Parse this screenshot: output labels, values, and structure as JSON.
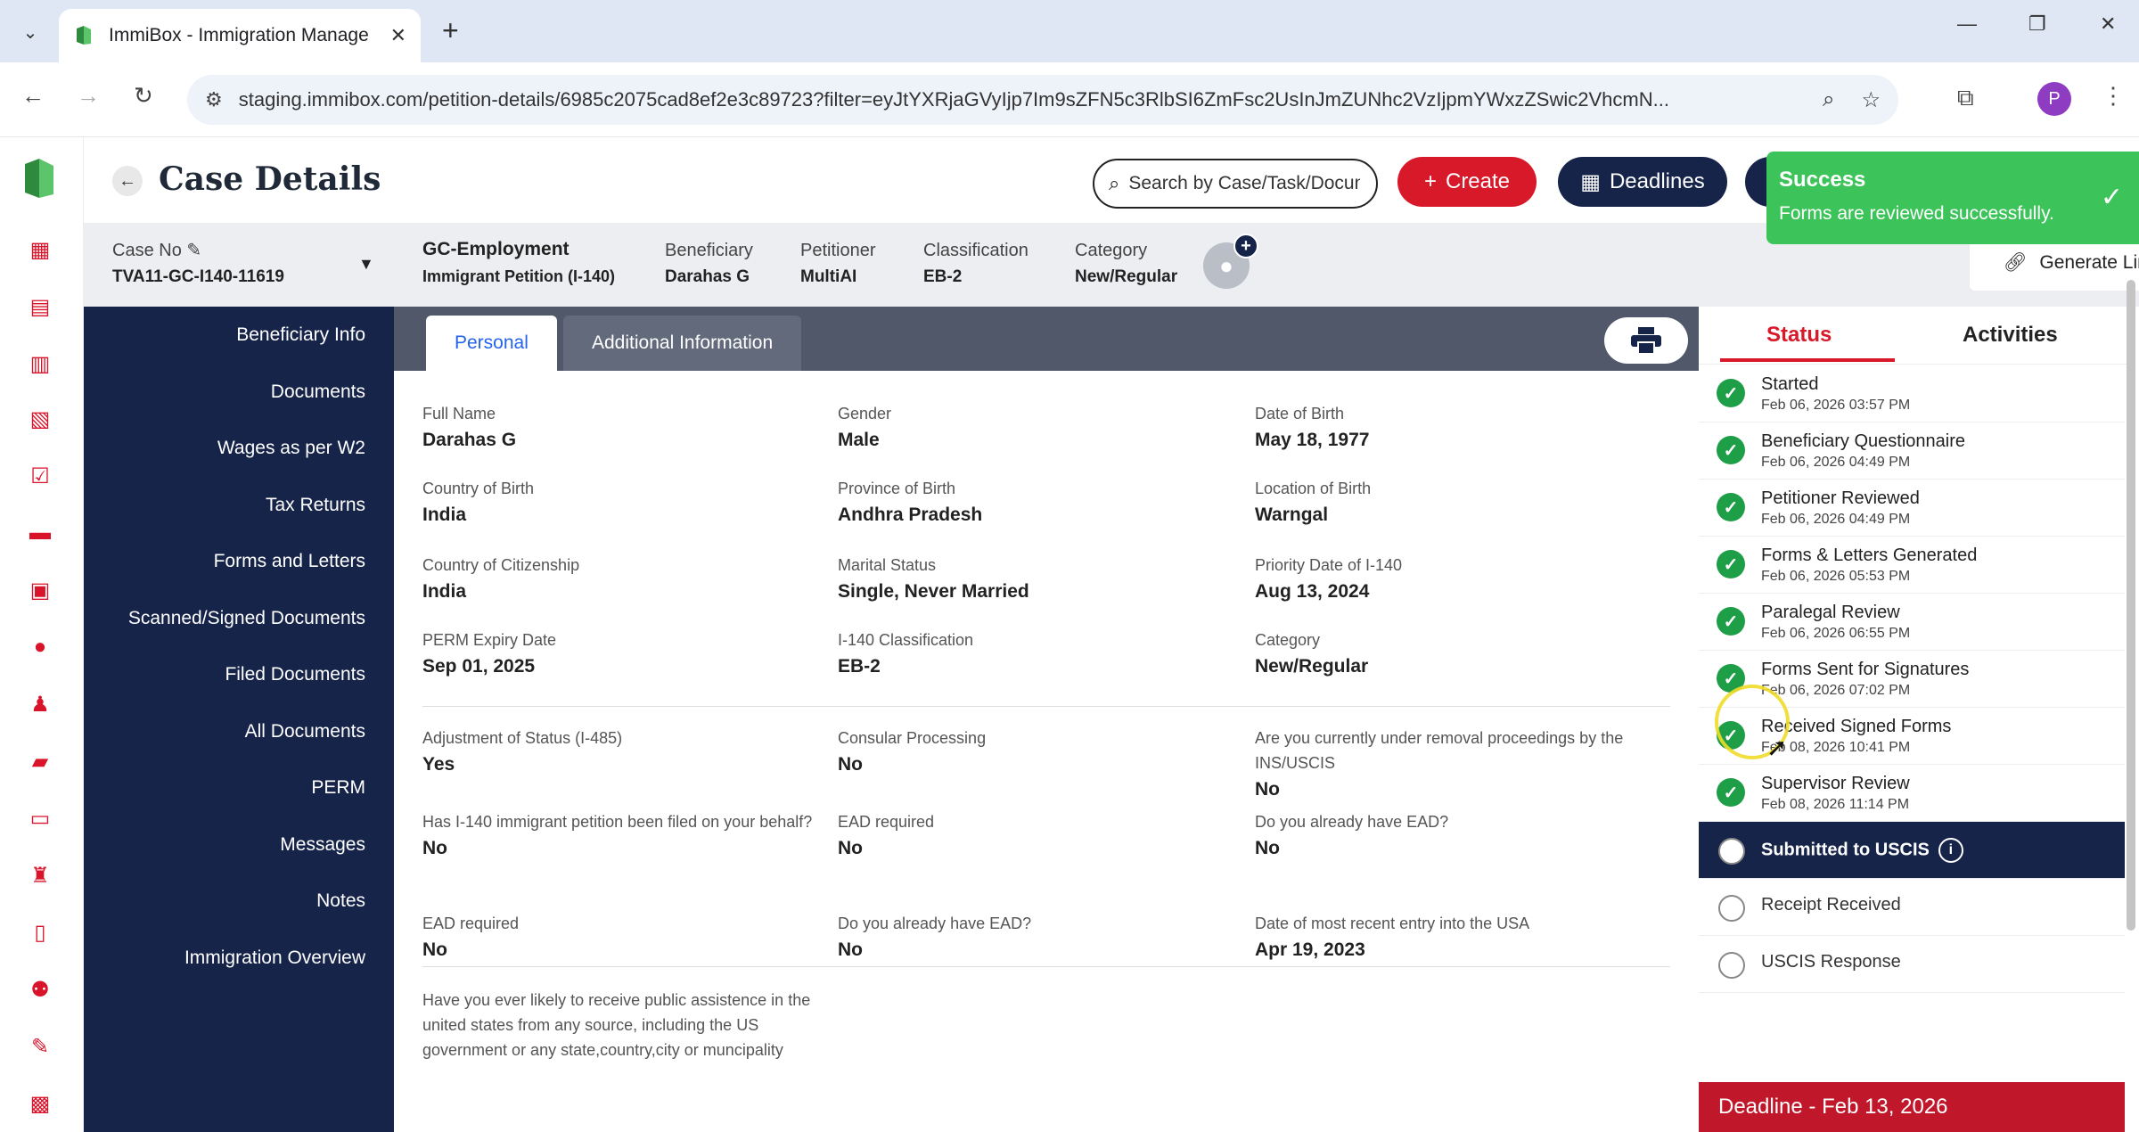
{
  "browser": {
    "tab_title": "ImmiBox - Immigration Manage",
    "url": "staging.immibox.com/petition-details/6985c2075cad8ef2e3c89723?filter=eyJtYXRjaGVyIjp7Im9sZFN5c3RlbSI6ZmFsc2UsInJmZUNhc2VzIjpmYWxzZSwic2VhcmN...",
    "profile_initial": "P"
  },
  "header": {
    "title": "Case Details",
    "search_placeholder": "Search by Case/Task/Document",
    "create_label": "Create",
    "deadlines_label": "Deadlines"
  },
  "toast": {
    "title": "Success",
    "message": "Forms are reviewed successfully."
  },
  "case_bar": {
    "case_no_label": "Case No",
    "case_no": "TVA11-GC-I140-11619",
    "case_type": "GC-Employment",
    "case_subtype": "Immigrant Petition (I-140)",
    "beneficiary_label": "Beneficiary",
    "beneficiary": "Darahas G",
    "petitioner_label": "Petitioner",
    "petitioner": "MultiAI",
    "classification_label": "Classification",
    "classification": "EB-2",
    "category_label": "Category",
    "category": "New/Regular",
    "generate_link_label": "Generate Link"
  },
  "left_nav": [
    "Beneficiary Info",
    "Documents",
    "Wages as per W2",
    "Tax Returns",
    "Forms and Letters",
    "Scanned/Signed Documents",
    "Filed Documents",
    "All Documents",
    "PERM",
    "Messages",
    "Notes",
    "Immigration Overview"
  ],
  "main": {
    "tabs": [
      "Personal",
      "Additional Information"
    ],
    "fields": [
      {
        "label": "Full Name",
        "value": "Darahas G"
      },
      {
        "label": "Gender",
        "value": "Male"
      },
      {
        "label": "Date of Birth",
        "value": "May 18, 1977"
      },
      {
        "label": "Country of Birth",
        "value": "India"
      },
      {
        "label": "Province of Birth",
        "value": "Andhra Pradesh"
      },
      {
        "label": "Location of Birth",
        "value": "Warngal"
      },
      {
        "label": "Country of Citizenship",
        "value": "India"
      },
      {
        "label": "Marital Status",
        "value": "Single, Never Married"
      },
      {
        "label": "Priority Date of I-140",
        "value": "Aug 13, 2024"
      },
      {
        "label": "PERM Expiry Date",
        "value": "Sep 01, 2025"
      },
      {
        "label": "I-140 Classification",
        "value": "EB-2"
      },
      {
        "label": "Category",
        "value": "New/Regular"
      },
      {
        "label": "Adjustment of Status (I-485)",
        "value": "Yes"
      },
      {
        "label": "Consular Processing",
        "value": "No"
      },
      {
        "label": "Are you currently under removal proceedings by the INS/USCIS",
        "value": "No"
      },
      {
        "label": "Has I-140 immigrant petition been filed on your behalf?",
        "value": "No"
      },
      {
        "label": "EAD required",
        "value": "No"
      },
      {
        "label": "Do you already have EAD?",
        "value": "No"
      },
      {
        "label": "EAD required",
        "value": "No"
      },
      {
        "label": "Do you already have EAD?",
        "value": "No"
      },
      {
        "label": "Date of most recent entry into the USA",
        "value": "Apr 19, 2023"
      },
      {
        "label": "Have you ever likely to receive public assistence in the united states from any source, including the US government or any state,country,city or muncipality",
        "value": ""
      }
    ]
  },
  "status_panel": {
    "tab_status": "Status",
    "tab_activities": "Activities",
    "steps": [
      {
        "name": "Started",
        "date": "Feb 06, 2026 03:57 PM",
        "state": "done"
      },
      {
        "name": "Beneficiary Questionnaire",
        "date": "Feb 06, 2026 04:49 PM",
        "state": "done"
      },
      {
        "name": "Petitioner Reviewed",
        "date": "Feb 06, 2026 04:49 PM",
        "state": "done"
      },
      {
        "name": "Forms & Letters Generated",
        "date": "Feb 06, 2026 05:53 PM",
        "state": "done"
      },
      {
        "name": "Paralegal Review",
        "date": "Feb 06, 2026 06:55 PM",
        "state": "done"
      },
      {
        "name": "Forms Sent for Signatures",
        "date": "Feb 06, 2026 07:02 PM",
        "state": "done"
      },
      {
        "name": "Received Signed Forms",
        "date": "Feb 08, 2026 10:41 PM",
        "state": "done"
      },
      {
        "name": "Supervisor Review",
        "date": "Feb 08, 2026 11:14 PM",
        "state": "done"
      },
      {
        "name": "Submitted to USCIS",
        "date": "",
        "state": "current"
      },
      {
        "name": "Receipt Received",
        "date": "",
        "state": "pending"
      },
      {
        "name": "USCIS Response",
        "date": "",
        "state": "pending"
      }
    ],
    "deadline": "Deadline - Feb 13, 2026"
  },
  "colors": {
    "brand_red": "#d7192a",
    "navy": "#16244a",
    "success_green": "#3cc45a",
    "done_green": "#1e9e46"
  }
}
